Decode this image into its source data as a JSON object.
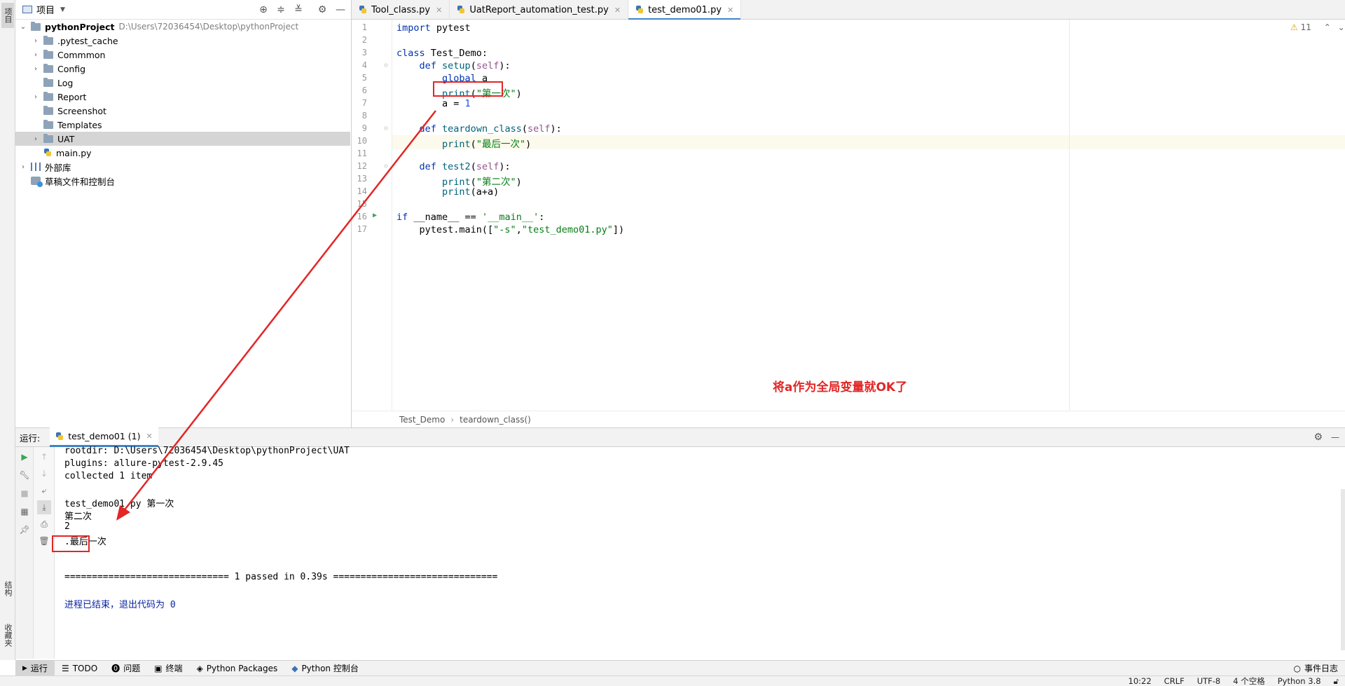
{
  "side_strip": {
    "project_tab": "项目",
    "structure_tab": "结构",
    "favorites_tab": "收藏夹"
  },
  "project_panel": {
    "title": "项目",
    "root": {
      "name": "pythonProject",
      "path": "D:\\Users\\72036454\\Desktop\\pythonProject"
    },
    "items": [
      {
        "name": ".pytest_cache",
        "type": "folder"
      },
      {
        "name": "Commmon",
        "type": "folder"
      },
      {
        "name": "Config",
        "type": "folder"
      },
      {
        "name": "Log",
        "type": "folder"
      },
      {
        "name": "Report",
        "type": "folder"
      },
      {
        "name": "Screenshot",
        "type": "folder"
      },
      {
        "name": "Templates",
        "type": "folder"
      },
      {
        "name": "UAT",
        "type": "folder"
      },
      {
        "name": "main.py",
        "type": "file"
      }
    ],
    "external_libs": "外部库",
    "scratches": "草稿文件和控制台"
  },
  "tabs": [
    {
      "label": "Tool_class.py"
    },
    {
      "label": "UatReport_automation_test.py"
    },
    {
      "label": "test_demo01.py"
    }
  ],
  "editor": {
    "warning_count": "11",
    "lines": [
      {
        "n": "1",
        "tokens": [
          [
            "kw",
            "import"
          ],
          [
            "",
            " pytest"
          ]
        ]
      },
      {
        "n": "2",
        "tokens": []
      },
      {
        "n": "3",
        "tokens": [
          [
            "kw",
            "class"
          ],
          [
            "",
            " Test_Demo:"
          ]
        ]
      },
      {
        "n": "4",
        "tokens": [
          [
            "",
            "    "
          ],
          [
            "kw",
            "def"
          ],
          [
            "",
            " "
          ],
          [
            "fn",
            "setup"
          ],
          [
            "",
            "("
          ],
          [
            "self",
            "self"
          ],
          [
            "",
            "):"
          ]
        ]
      },
      {
        "n": "5",
        "tokens": [
          [
            "",
            "        "
          ],
          [
            "kw",
            "global"
          ],
          [
            "",
            " a"
          ]
        ]
      },
      {
        "n": "6",
        "tokens": [
          [
            "",
            "        "
          ],
          [
            "fn",
            "print"
          ],
          [
            "",
            "("
          ],
          [
            "str",
            "\"第一次\""
          ],
          [
            "",
            ")"
          ]
        ]
      },
      {
        "n": "7",
        "tokens": [
          [
            "",
            "        a = "
          ],
          [
            "num",
            "1"
          ]
        ]
      },
      {
        "n": "8",
        "tokens": []
      },
      {
        "n": "9",
        "tokens": [
          [
            "",
            "    "
          ],
          [
            "kw",
            "def"
          ],
          [
            "",
            " "
          ],
          [
            "fn",
            "teardown_class"
          ],
          [
            "",
            "("
          ],
          [
            "self",
            "self"
          ],
          [
            "",
            "):"
          ]
        ]
      },
      {
        "n": "10",
        "tokens": [
          [
            "",
            "        "
          ],
          [
            "fn",
            "print"
          ],
          [
            "",
            "("
          ],
          [
            "str",
            "\"最后一次\""
          ],
          [
            "",
            ")"
          ]
        ]
      },
      {
        "n": "11",
        "tokens": []
      },
      {
        "n": "12",
        "tokens": [
          [
            "",
            "    "
          ],
          [
            "kw",
            "def"
          ],
          [
            "",
            " "
          ],
          [
            "fn",
            "test2"
          ],
          [
            "",
            "("
          ],
          [
            "self",
            "self"
          ],
          [
            "",
            "):"
          ]
        ]
      },
      {
        "n": "13",
        "tokens": [
          [
            "",
            "        "
          ],
          [
            "fn",
            "print"
          ],
          [
            "",
            "("
          ],
          [
            "str",
            "\"第二次\""
          ],
          [
            "",
            ")"
          ]
        ]
      },
      {
        "n": "14",
        "tokens": [
          [
            "",
            "        "
          ],
          [
            "fn",
            "print"
          ],
          [
            "",
            "(a+a)"
          ]
        ]
      },
      {
        "n": "15",
        "tokens": []
      },
      {
        "n": "16",
        "tokens": [
          [
            "kw",
            "if"
          ],
          [
            "",
            " __name__ == "
          ],
          [
            "str",
            "'__main__'"
          ],
          [
            "",
            ":"
          ]
        ]
      },
      {
        "n": "17",
        "tokens": [
          [
            "",
            "    pytest.main(["
          ],
          [
            "str",
            "\"-s\""
          ],
          [
            "",
            ","
          ],
          [
            "str",
            "\"test_demo01.py\""
          ],
          [
            "",
            "])"
          ]
        ]
      }
    ],
    "annotation": "将a作为全局变量就OK了"
  },
  "breadcrumb": {
    "class_name": "Test_Demo",
    "method_name": "teardown_class()"
  },
  "run": {
    "label": "运行:",
    "tab": "test_demo01 (1)",
    "console": [
      {
        "text": "rootdir: D:\\Users\\72036454\\Desktop\\pythonProject\\UAT",
        "style": ""
      },
      {
        "text": "plugins: allure-pytest-2.9.45",
        "style": ""
      },
      {
        "text": "collected 1 item",
        "style": ""
      },
      {
        "text": "",
        "style": ""
      },
      {
        "text": "test_demo01.py 第一次",
        "style": ""
      },
      {
        "text": "第二次",
        "style": ""
      },
      {
        "text": "2",
        "style": ""
      },
      {
        "text": ".最后一次",
        "style": ""
      },
      {
        "text": "",
        "style": ""
      },
      {
        "text": "",
        "style": ""
      },
      {
        "text": "============================== 1 passed in 0.39s ==============================",
        "style": ""
      },
      {
        "text": "",
        "style": ""
      },
      {
        "text": "进程已结束，退出代码为 0",
        "style": "blue"
      }
    ]
  },
  "bottom_tools": [
    "运行",
    "TODO",
    "问题",
    "终端",
    "Python Packages",
    "Python 控制台"
  ],
  "event_log": "事件日志",
  "status_bar": {
    "position": "10:22",
    "line_sep": "CRLF",
    "encoding": "UTF-8",
    "indent": "4 个空格",
    "interpreter": "Python 3.8"
  },
  "colors": {
    "accent": "#4083c9",
    "annotation_red": "#e32626",
    "keyword": "#0033b3",
    "string": "#067d17"
  }
}
